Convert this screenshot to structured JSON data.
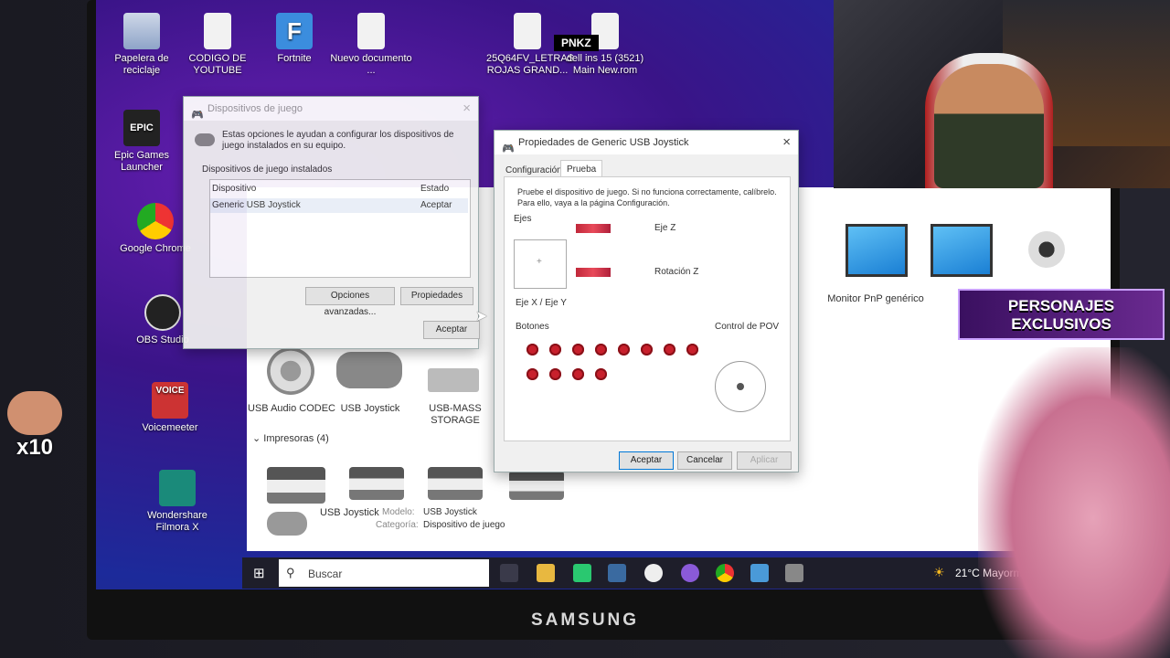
{
  "desktop": {
    "icons": [
      {
        "label": "Papelera de reciclaje"
      },
      {
        "label": "CODIGO DE YOUTUBE"
      },
      {
        "label": "Fortnite"
      },
      {
        "label": "Nuevo documento ..."
      },
      {
        "label": "25Q64FV_LETRAS ROJAS GRAND..."
      },
      {
        "label": "dell ins 15 (3521) Main New.rom"
      },
      {
        "label": "Epic Games Launcher"
      },
      {
        "label": "Google Chrome"
      },
      {
        "label": "OBS Studio"
      },
      {
        "label": "Voicemeeter"
      },
      {
        "label": "Wondershare Filmora X"
      }
    ]
  },
  "game_devices": {
    "title": "Dispositivos de juego",
    "description": "Estas opciones le ayudan a configurar los dispositivos de juego instalados en su equipo.",
    "section": "Dispositivos de juego instalados",
    "col_device": "Dispositivo",
    "col_status": "Estado",
    "row_device": "Generic   USB  Joystick",
    "row_status": "Aceptar",
    "btn_advanced": "Opciones avanzadas...",
    "btn_properties": "Propiedades",
    "btn_accept": "Aceptar"
  },
  "props": {
    "title": "Propiedades de Generic   USB  Joystick",
    "tab_config": "Configuración",
    "tab_test": "Prueba",
    "instruction": "Pruebe el dispositivo de juego. Si no funciona correctamente, calíbrelo. Para ello, vaya a la página Configuración.",
    "axes_group": "Ejes",
    "axis_z": "Eje Z",
    "rot_z": "Rotación Z",
    "axis_xy": "Eje X / Eje Y",
    "buttons_group": "Botones",
    "pov_group": "Control de POV",
    "btn_ok": "Aceptar",
    "btn_cancel": "Cancelar",
    "btn_apply": "Aplicar"
  },
  "control_panel": {
    "devices": [
      {
        "label": "USB Audio CODEC"
      },
      {
        "label": "USB Joystick"
      },
      {
        "label": "USB-MASS STORAGE"
      },
      {
        "label": "Monitor PnP genérico"
      }
    ],
    "printers_header": "Impresoras (4)",
    "detail_name": "USB Joystick",
    "detail_model_label": "Modelo:",
    "detail_model": "USB Joystick",
    "detail_category_label": "Categoría:",
    "detail_category": "Dispositivo de juego"
  },
  "taskbar": {
    "search_placeholder": "Buscar",
    "weather": "21°C  Mayorm. soleado"
  },
  "monitor_brand": "SAMSUNG",
  "overlays": {
    "pnkz": "PNKZ",
    "promo": "PERSONAJES EXCLUSIVOS",
    "x10": "x10"
  }
}
